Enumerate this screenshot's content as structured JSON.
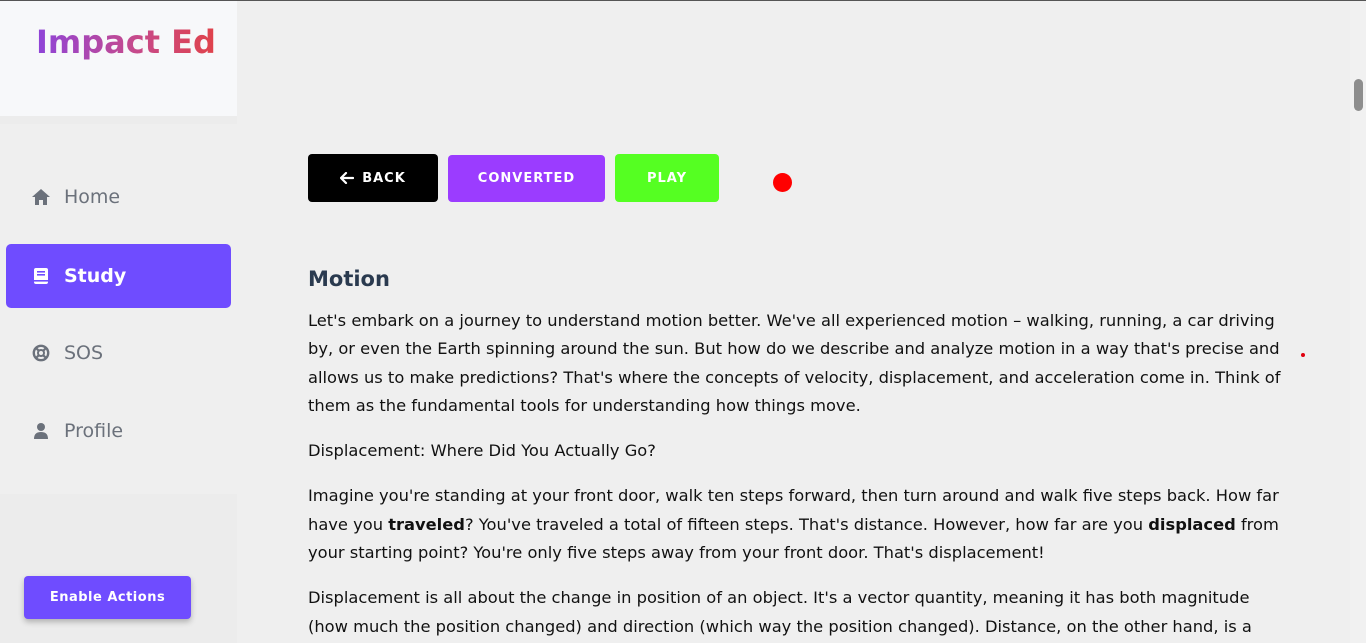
{
  "brand": {
    "name": "Impact Ed"
  },
  "sidebar": {
    "items": [
      {
        "label": "Home",
        "icon": "home-icon"
      },
      {
        "label": "Study",
        "icon": "book-icon",
        "active": true
      },
      {
        "label": "SOS",
        "icon": "lifebuoy-icon"
      },
      {
        "label": "Profile",
        "icon": "user-icon"
      }
    ],
    "enable_actions_label": "Enable Actions"
  },
  "toolbar": {
    "back_label": "BACK",
    "converted_label": "CONVERTED",
    "play_label": "PLAY"
  },
  "article": {
    "title": "Motion",
    "p1": "Let's embark on a journey to understand motion better. We've all experienced motion – walking, running, a car driving by, or even the Earth spinning around the sun. But how do we describe and analyze motion in a way that's precise and allows us to make predictions? That's where the concepts of velocity, displacement, and acceleration come in. Think of them as the fundamental tools for understanding how things move.",
    "p2": "Displacement: Where Did You Actually Go?",
    "p3_a": "Imagine you're standing at your front door, walk ten steps forward, then turn around and walk five steps back. How far have you ",
    "p3_b": "traveled",
    "p3_c": "? You've traveled a total of fifteen steps. That's distance. However, how far are you ",
    "p3_d": "displaced",
    "p3_e": " from your starting point? You're only five steps away from your front door. That's displacement!",
    "p4": "Displacement is all about the change in position of an object. It's a vector quantity, meaning it has both magnitude (how much the position changed) and direction (which way the position changed). Distance, on the other hand, is a"
  },
  "colors": {
    "accent": "#6f4cff",
    "converted": "#9b3cff",
    "play": "#55ff22",
    "back": "#000000",
    "record_dot": "#ff0000"
  }
}
